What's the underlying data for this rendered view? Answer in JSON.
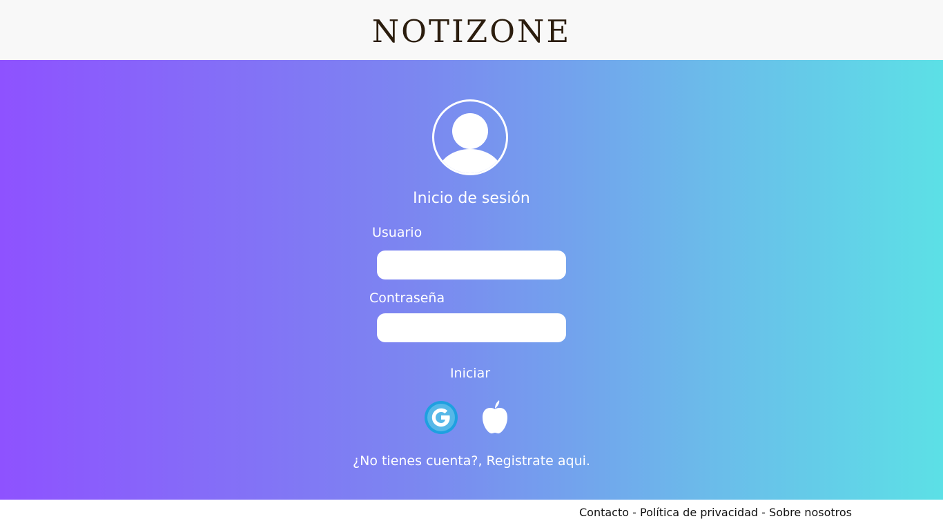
{
  "header": {
    "logo": "NOTIZONE"
  },
  "login": {
    "title": "Inicio de sesión",
    "user_label": "Usuario",
    "user_value": "",
    "password_label": "Contraseña",
    "password_value": "",
    "submit_label": "Iniciar",
    "register_text": "¿No tienes cuenta?, Registrate aqui."
  },
  "social": [
    {
      "icon": "google-icon",
      "color": "#1ea0e0"
    },
    {
      "icon": "apple-icon",
      "color": "#ffffff"
    }
  ],
  "footer": {
    "contact": "Contacto",
    "separator": "-",
    "privacy": "Política de privacidad",
    "about": "Sobre nosotros"
  },
  "colors": {
    "gradient_start": "#8e52ff",
    "gradient_end": "#5ce0e6",
    "header_bg": "#f8f8f8",
    "logo": "#2b1d0e"
  }
}
